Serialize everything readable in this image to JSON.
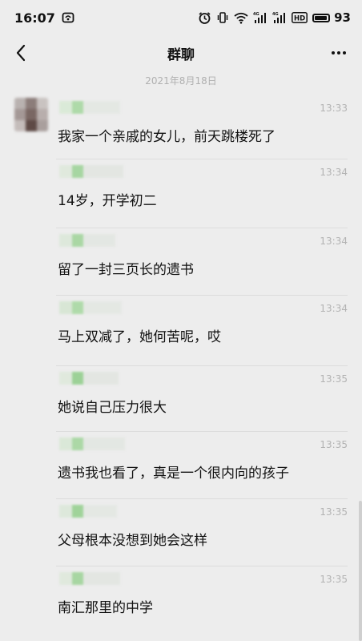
{
  "status_bar": {
    "time": "16:07",
    "battery_percent": "93",
    "icons": [
      "notification-app-icon",
      "alarm-icon",
      "vibrate-icon",
      "wifi-icon",
      "signal-4g-icon",
      "signal-4g-icon",
      "hd-icon",
      "battery-icon"
    ]
  },
  "nav": {
    "title": "群聊",
    "back_icon": "chevron-left-icon",
    "more_icon": "more-dots-icon"
  },
  "date_separator": "2021年8月18日",
  "messages": [
    {
      "time": "13:33",
      "text": "我家一个亲戚的女儿，前天跳楼死了"
    },
    {
      "time": "13:34",
      "text": "14岁，开学初二"
    },
    {
      "time": "13:34",
      "text": "留了一封三页长的遗书"
    },
    {
      "time": "13:34",
      "text": "马上双减了，她何苦呢，哎"
    },
    {
      "time": "13:35",
      "text": "她说自己压力很大"
    },
    {
      "time": "13:35",
      "text": "遗书我也看了，真是一个很内向的孩子"
    },
    {
      "time": "13:35",
      "text": "父母根本没想到她会这样"
    },
    {
      "time": "13:35",
      "text": "南汇那里的中学"
    }
  ],
  "colors": {
    "background": "#ededed",
    "divider": "#dcdcdc",
    "timestamp": "#b3b3b3",
    "blur_green": "#9fd49a"
  }
}
